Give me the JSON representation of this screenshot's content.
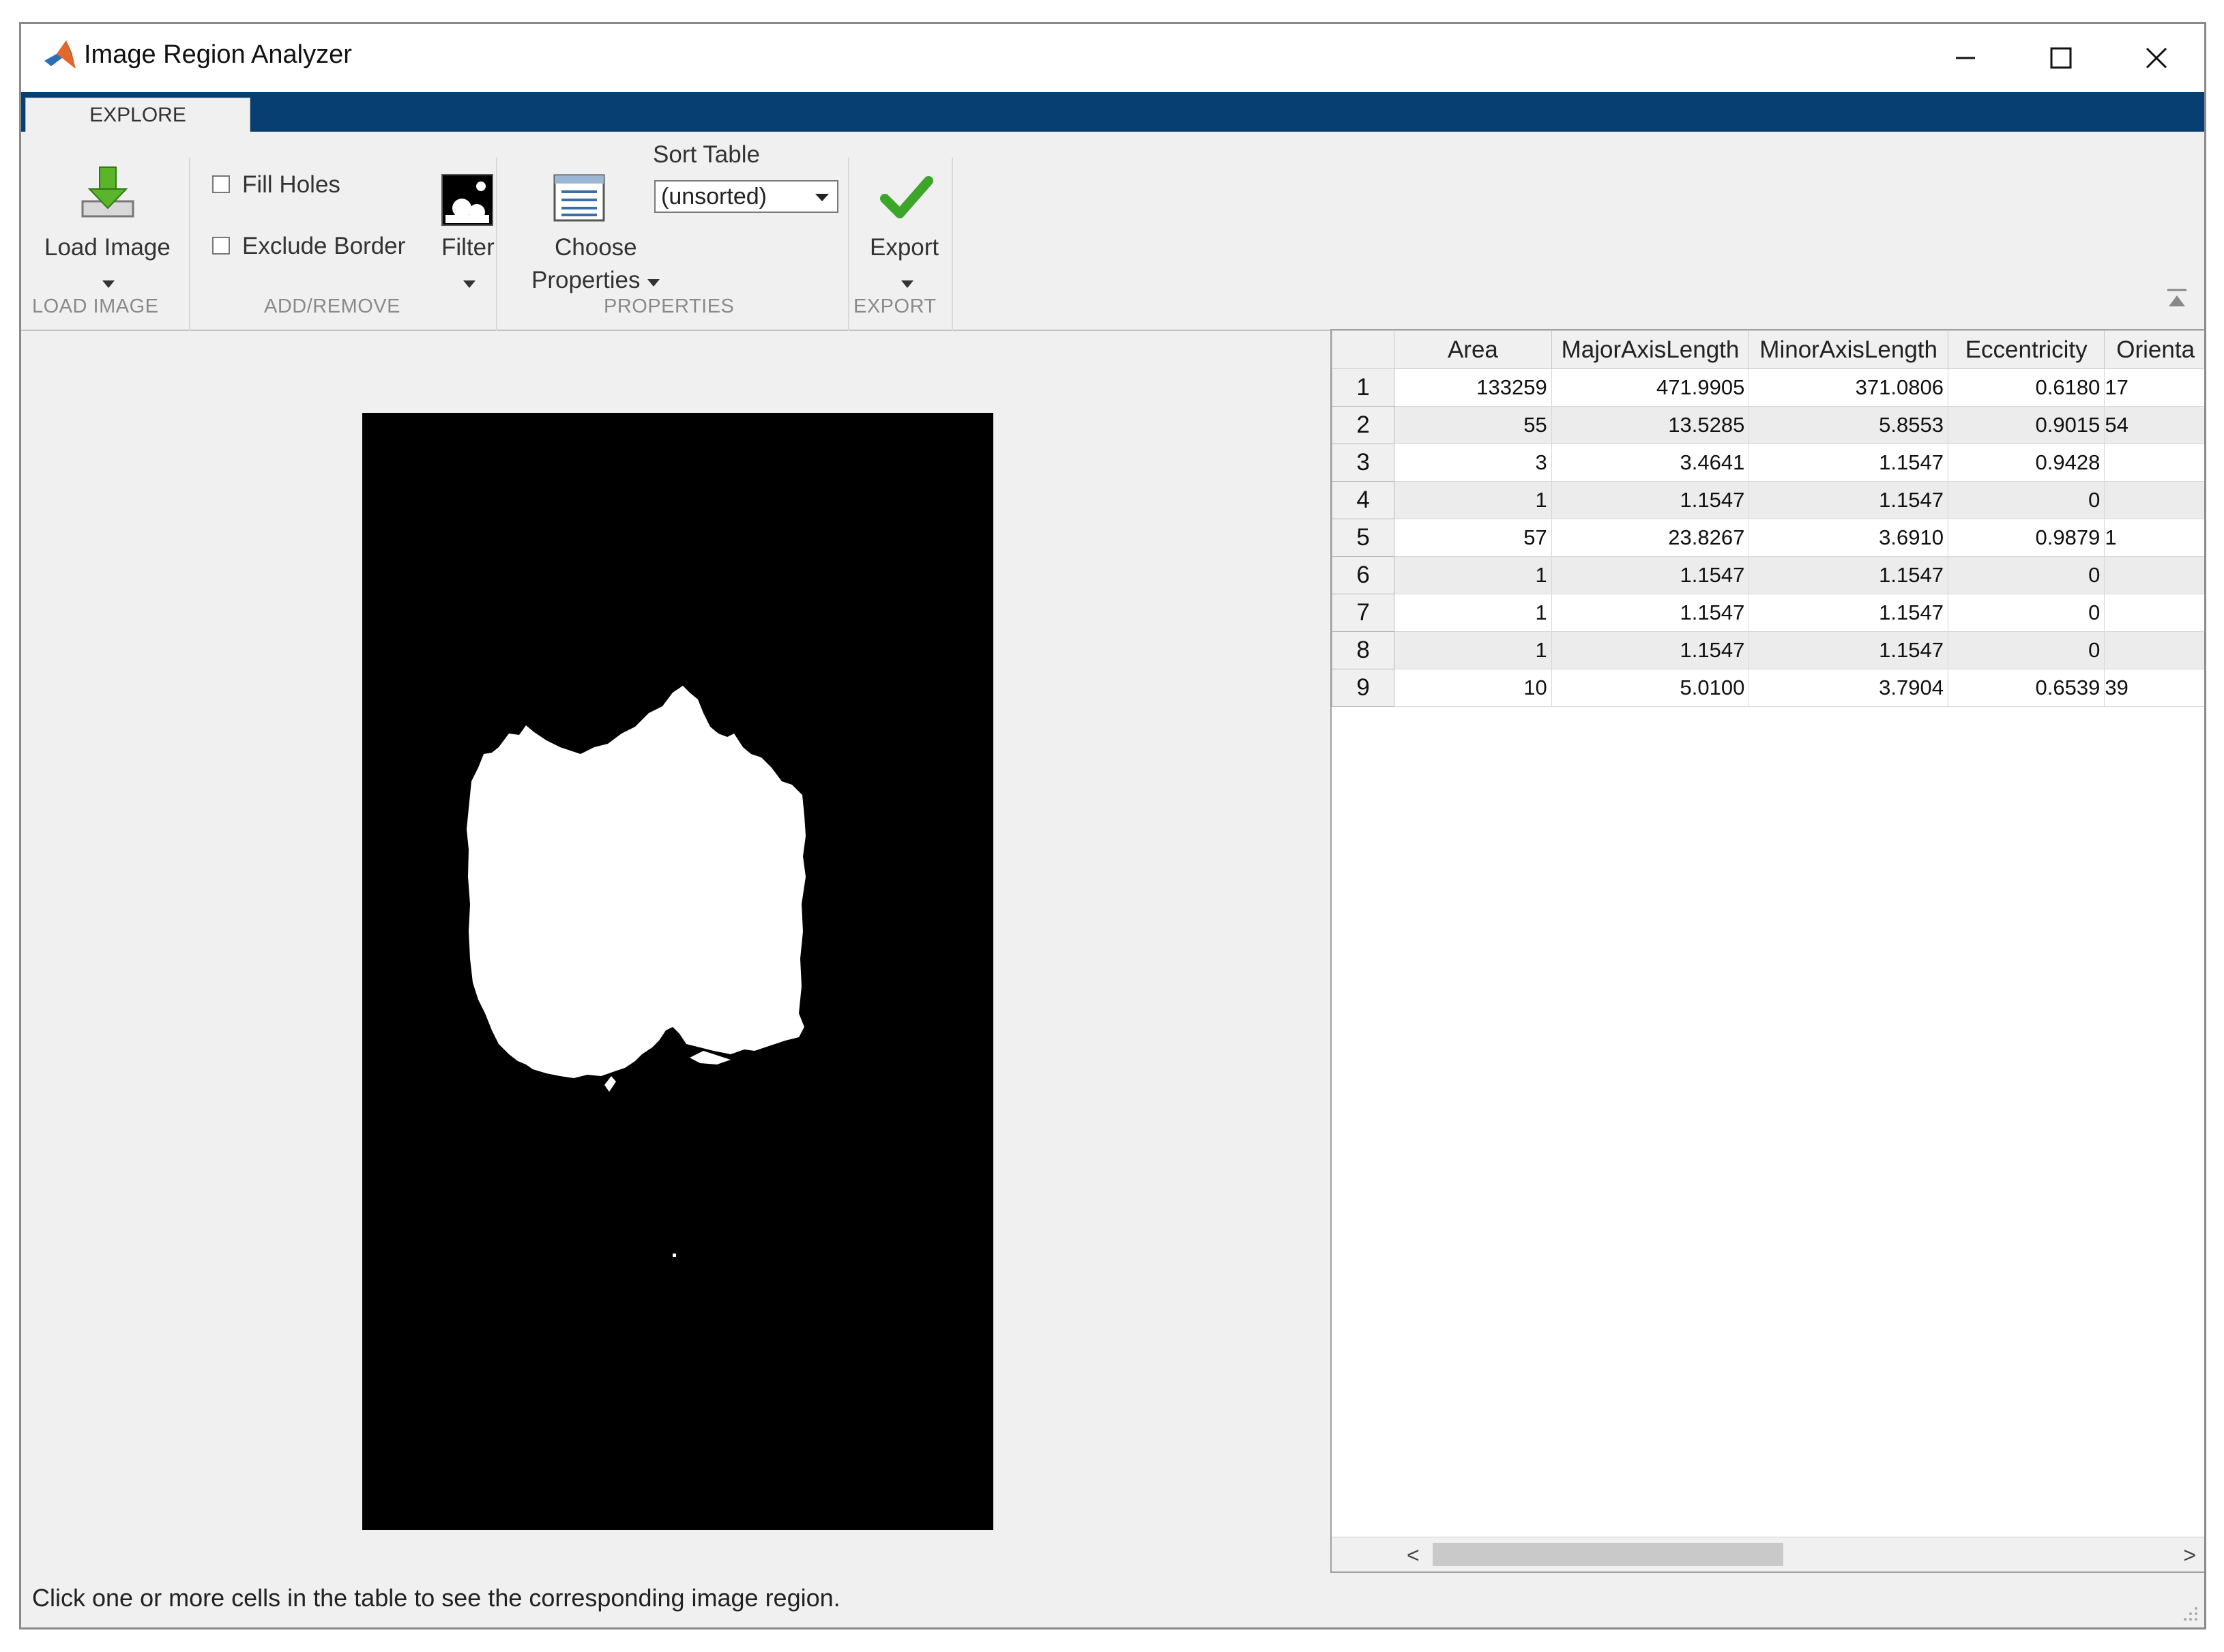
{
  "window": {
    "title": "Image Region Analyzer",
    "accent": "#073f73"
  },
  "tabs": [
    {
      "label": "EXPLORE"
    }
  ],
  "ribbon": {
    "load_image": {
      "label": "Load Image",
      "section": "LOAD IMAGE"
    },
    "add_remove": {
      "fill_holes": {
        "label": "Fill Holes",
        "checked": false
      },
      "exclude_border": {
        "label": "Exclude Border",
        "checked": false
      },
      "filter_label": "Filter",
      "section": "ADD/REMOVE"
    },
    "properties": {
      "choose_line1": "Choose",
      "choose_line2": "Properties",
      "sort_label": "Sort Table",
      "sort_value": "(unsorted)",
      "section": "PROPERTIES"
    },
    "export": {
      "label": "Export",
      "section": "EXPORT"
    }
  },
  "table": {
    "columns": [
      "Area",
      "MajorAxisLength",
      "MinorAxisLength",
      "Eccentricity",
      "Orienta"
    ],
    "rows": [
      {
        "id": "1",
        "area": "133259",
        "major": "471.9905",
        "minor": "371.0806",
        "ecc": "0.6180",
        "orient": "17"
      },
      {
        "id": "2",
        "area": "55",
        "major": "13.5285",
        "minor": "5.8553",
        "ecc": "0.9015",
        "orient": "54"
      },
      {
        "id": "3",
        "area": "3",
        "major": "3.4641",
        "minor": "1.1547",
        "ecc": "0.9428",
        "orient": ""
      },
      {
        "id": "4",
        "area": "1",
        "major": "1.1547",
        "minor": "1.1547",
        "ecc": "0",
        "orient": ""
      },
      {
        "id": "5",
        "area": "57",
        "major": "23.8267",
        "minor": "3.6910",
        "ecc": "0.9879",
        "orient": "1"
      },
      {
        "id": "6",
        "area": "1",
        "major": "1.1547",
        "minor": "1.1547",
        "ecc": "0",
        "orient": ""
      },
      {
        "id": "7",
        "area": "1",
        "major": "1.1547",
        "minor": "1.1547",
        "ecc": "0",
        "orient": ""
      },
      {
        "id": "8",
        "area": "1",
        "major": "1.1547",
        "minor": "1.1547",
        "ecc": "0",
        "orient": ""
      },
      {
        "id": "9",
        "area": "10",
        "major": "5.0100",
        "minor": "3.7904",
        "ecc": "0.6539",
        "orient": "39"
      }
    ]
  },
  "status": "Click one or more cells in the table to see the corresponding image region."
}
